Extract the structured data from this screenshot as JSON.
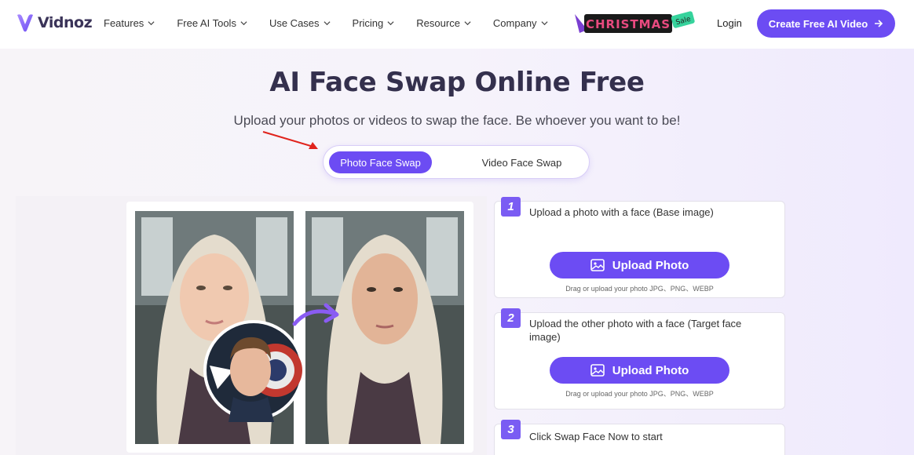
{
  "nav": {
    "logo_text": "Vidnoz",
    "menu": [
      {
        "label": "Features"
      },
      {
        "label": "Free AI Tools"
      },
      {
        "label": "Use Cases"
      },
      {
        "label": "Pricing"
      },
      {
        "label": "Resource"
      },
      {
        "label": "Company"
      }
    ],
    "promo_text": "CHRISTMAS",
    "promo_tag": "Sale",
    "login_label": "Login",
    "cta_label": "Create Free AI Video",
    "cta_icon": "arrow-right-icon"
  },
  "hero": {
    "title": "AI Face Swap Online Free",
    "subtitle": "Upload your photos or videos to swap the face. Be whoever you want to be!"
  },
  "tabs": {
    "active": "Photo Face Swap",
    "inactive": "Video Face Swap"
  },
  "steps": [
    {
      "num": "1",
      "text": "Upload a photo with a face (Base image)",
      "button": "Upload Photo",
      "hint": "Drag or upload your photo JPG、PNG、WEBP"
    },
    {
      "num": "2",
      "text": "Upload the other photo with a face (Target face image)",
      "button": "Upload Photo",
      "hint": "Drag or upload your photo JPG、PNG、WEBP"
    },
    {
      "num": "3",
      "text": "Click Swap Face Now to start"
    }
  ],
  "colors": {
    "accent": "#6c4cf3",
    "title": "#34304d",
    "annotation": "#e0231c"
  }
}
